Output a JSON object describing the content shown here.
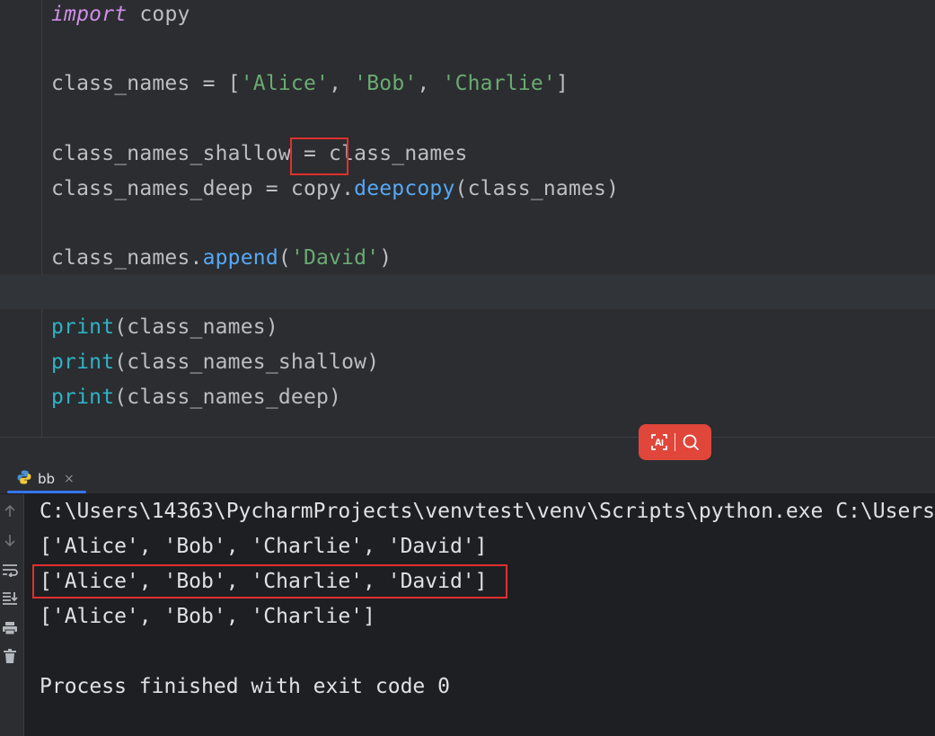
{
  "editor": {
    "lines": {
      "l1_kw": "import",
      "l1_rest": " copy",
      "l2_a": "class_names = [",
      "l2_s1": "'Alice'",
      "l2_c1": ", ",
      "l2_s2": "'Bob'",
      "l2_c2": ", ",
      "l2_s3": "'Charlie'",
      "l2_end": "]",
      "l3": "class_names_shallow = class_names",
      "l4_a": "class_names_deep = copy.",
      "l4_fn": "deepcopy",
      "l4_b": "(class_names)",
      "l5_a": "class_names.",
      "l5_fn": "append",
      "l5_b": "(",
      "l5_s": "'David'",
      "l5_c": ")",
      "l6_fn": "print",
      "l6_b": "(class_names)",
      "l7_fn": "print",
      "l7_b": "(class_names_shallow)",
      "l8_fn": "print",
      "l8_b": "(class_names_deep)"
    }
  },
  "toolbar": {
    "ai_icon": "ai-translate-icon",
    "search_icon": "search-icon"
  },
  "run": {
    "tab_label": "bb",
    "close_glyph": "×",
    "side_icons": [
      "arrow-up-icon",
      "arrow-down-icon",
      "soft-wrap-icon",
      "scroll-to-end-icon",
      "print-icon",
      "trash-icon"
    ]
  },
  "console": {
    "lines": [
      "C:\\Users\\14363\\PycharmProjects\\venvtest\\venv\\Scripts\\python.exe C:\\Users",
      "['Alice', 'Bob', 'Charlie', 'David']",
      "['Alice', 'Bob', 'Charlie', 'David']",
      "['Alice', 'Bob', 'Charlie']",
      "",
      "Process finished with exit code 0"
    ]
  },
  "colors": {
    "keyword": "#cf8ee8",
    "string": "#6aab73",
    "function": "#56a8f5",
    "builtin": "#2fb3c6",
    "highlight_box": "#e0302d",
    "ai_toolbar": "#e0463a",
    "tab_underline": "#3574f0"
  }
}
